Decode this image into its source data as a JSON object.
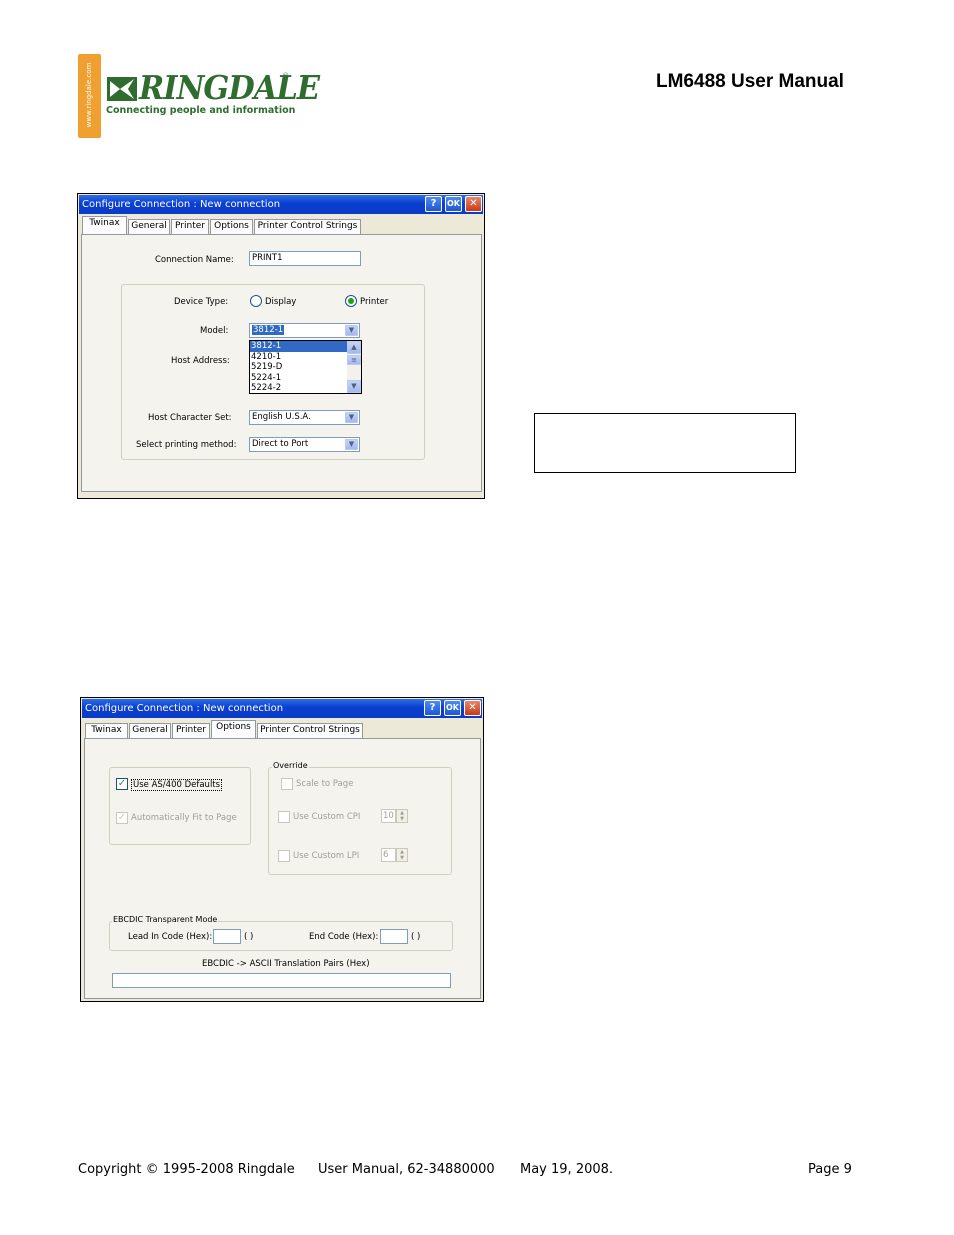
{
  "header": {
    "logo_url": "www.ringdale.com",
    "logo_name": "RINGDALE",
    "logo_reg": "®",
    "logo_tagline": "Connecting people and information",
    "manual_title": "LM6488 User Manual"
  },
  "colors": {
    "brand_green": "#2e6d2e",
    "brand_orange": "#f0a030",
    "titlebar_blue": "#0a3fd0"
  },
  "dialog1": {
    "title": "Configure Connection : New connection",
    "help": "?",
    "ok": "OK",
    "close": "✕",
    "tabs": [
      "Twinax",
      "General",
      "Printer",
      "Options",
      "Printer Control Strings"
    ],
    "active_tab": "Twinax",
    "connection_name_label": "Connection Name:",
    "connection_name_value": "PRINT1",
    "device_type_label": "Device Type:",
    "device_type_display": "Display",
    "device_type_printer": "Printer",
    "device_type_selected": "Printer",
    "model_label": "Model:",
    "model_value": "3812-1",
    "model_list": [
      "3812-1",
      "4210-1",
      "5219-D",
      "5224-1",
      "5224-2"
    ],
    "host_address_label": "Host Address:",
    "host_charset_label": "Host Character Set:",
    "host_charset_value": "English U.S.A.",
    "print_method_label": "Select printing method:",
    "print_method_value": "Direct to Port"
  },
  "dialog2": {
    "title": "Configure Connection : New connection",
    "help": "?",
    "ok": "OK",
    "close": "✕",
    "tabs": [
      "Twinax",
      "General",
      "Printer",
      "Options",
      "Printer Control Strings"
    ],
    "active_tab": "Options",
    "use_as400_defaults": "Use AS/400 Defaults",
    "use_as400_checked": true,
    "auto_fit": "Automatically Fit to Page",
    "auto_fit_checked": true,
    "override_label": "Override",
    "scale_to_page": "Scale to Page",
    "use_custom_cpi": "Use Custom CPI",
    "cpi_value": "10",
    "use_custom_lpi": "Use Custom LPI",
    "lpi_value": "6",
    "ebcdic_label": "EBCDIC Transparent Mode",
    "lead_in_label": "Lead In Code (Hex):",
    "end_code_label": "End Code (Hex):",
    "paren": "(    )",
    "translation_label": "EBCDIC -> ASCII Translation Pairs (Hex)"
  },
  "footer": {
    "copyright": "Copyright © 1995-2008 Ringdale",
    "doc_id": "User Manual, 62-34880000",
    "date": "May 19, 2008.",
    "page": "Page 9"
  }
}
